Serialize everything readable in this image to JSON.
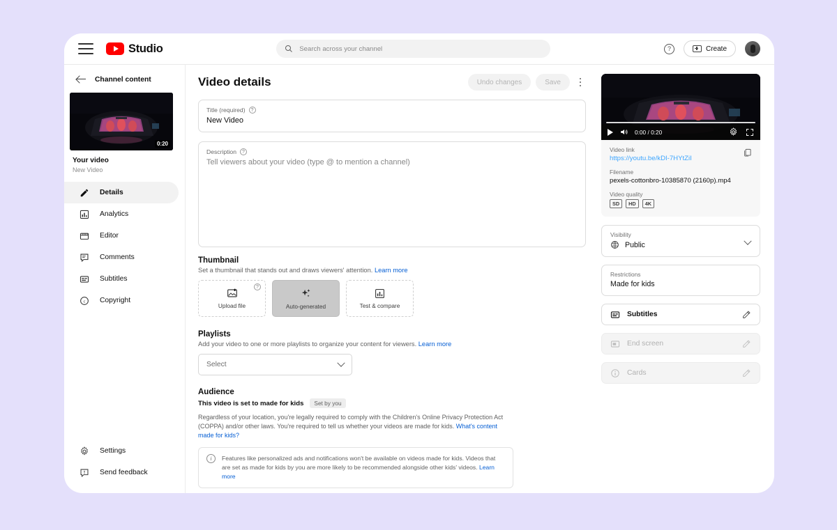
{
  "topbar": {
    "brand_name": "Studio",
    "menu_icon": "hamburger-icon",
    "search_placeholder": "Search across your channel",
    "search_value": "",
    "help_label": "?",
    "create_label": "Create"
  },
  "leftnav": {
    "back_label": "Channel content",
    "video_duration": "0:20",
    "video_heading": "Your video",
    "video_subtitle": "New Video",
    "items": [
      {
        "label": "Details",
        "icon": "pencil-icon",
        "active": true
      },
      {
        "label": "Analytics",
        "icon": "bar-chart-icon",
        "active": false
      },
      {
        "label": "Editor",
        "icon": "clapper-icon",
        "active": false
      },
      {
        "label": "Comments",
        "icon": "comment-icon",
        "active": false
      },
      {
        "label": "Subtitles",
        "icon": "subtitles-icon",
        "active": false
      },
      {
        "label": "Copyright",
        "icon": "copyright-icon",
        "active": false
      }
    ],
    "bottom_items": [
      {
        "label": "Settings",
        "icon": "gear-icon"
      },
      {
        "label": "Send feedback",
        "icon": "feedback-icon"
      }
    ]
  },
  "main": {
    "page_title": "Video details",
    "undo_label": "Undo changes",
    "save_label": "Save",
    "title_field": {
      "label": "Title (required)",
      "value": "New Video"
    },
    "description_field": {
      "label": "Description",
      "placeholder": "Tell viewers about your video (type @ to mention a channel)",
      "value": ""
    },
    "thumbnail": {
      "heading": "Thumbnail",
      "subtext": "Set a thumbnail that stands out and draws viewers' attention.",
      "learn_more": "Learn more",
      "options": [
        {
          "label": "Upload file",
          "icon": "image-upload-icon",
          "selected": false
        },
        {
          "label": "Auto-generated",
          "icon": "sparkle-icon",
          "selected": true
        },
        {
          "label": "Test & compare",
          "icon": "bar-chart-icon",
          "selected": false
        }
      ]
    },
    "playlists": {
      "heading": "Playlists",
      "subtext": "Add your video to one or more playlists to organize your content for viewers.",
      "learn_more": "Learn more",
      "select_value": "Select"
    },
    "audience": {
      "heading": "Audience",
      "status_text": "This video is set to made for kids",
      "status_badge": "Set by you",
      "legal_text": "Regardless of your location, you're legally required to comply with the Children's Online Privacy Protection Act (COPPA) and/or other laws. You're required to tell us whether your videos are made for kids.",
      "legal_link": "What's content made for kids?",
      "info_text": "Features like personalized ads and notifications won't be available on videos made for kids. Videos that are set as made for kids by you are more likely to be recommended alongside other kids' videos.",
      "info_link": "Learn more"
    }
  },
  "right": {
    "player": {
      "time": "0:00 / 0:20",
      "play_icon": "play-icon",
      "volume_icon": "volume-icon",
      "settings_icon": "gear-icon",
      "fullscreen_icon": "fullscreen-icon"
    },
    "video_link_label": "Video link",
    "video_link_value": "https://youtu.be/kDI-7HYtZiI",
    "filename_label": "Filename",
    "filename_value": "pexels-cottonbro-10385870 (2160p).mp4",
    "quality_label": "Video quality",
    "quality_badges": [
      "SD",
      "HD",
      "4K"
    ],
    "visibility_label": "Visibility",
    "visibility_value": "Public",
    "restrictions_label": "Restrictions",
    "restrictions_value": "Made for kids",
    "rows": [
      {
        "label": "Subtitles",
        "icon": "subtitles-icon",
        "disabled": false
      },
      {
        "label": "End screen",
        "icon": "endscreen-icon",
        "disabled": true
      },
      {
        "label": "Cards",
        "icon": "info-icon",
        "disabled": true
      }
    ]
  },
  "colors": {
    "brand_red": "#ff0000",
    "link_blue": "#065fd4",
    "player_link": "#3ea6ff",
    "page_bg": "#e4e0fb"
  }
}
